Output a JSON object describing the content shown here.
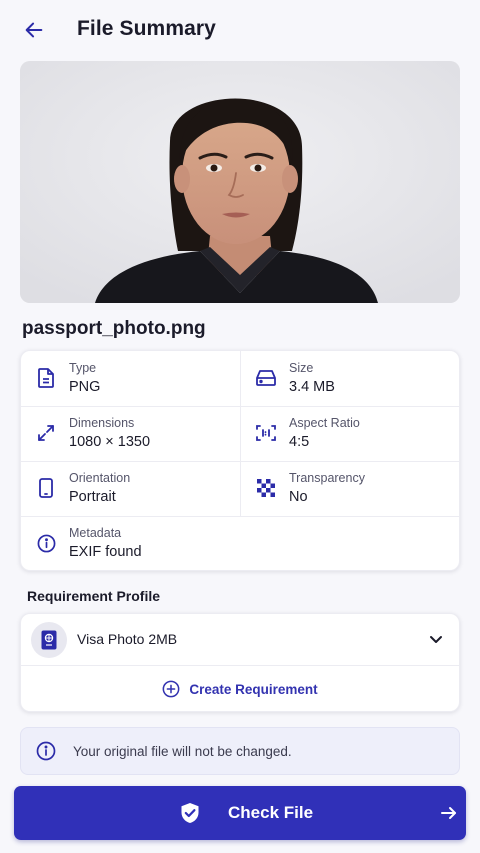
{
  "header": {
    "title": "File Summary"
  },
  "file": {
    "name": "passport_photo.png"
  },
  "details": {
    "type": {
      "label": "Type",
      "value": "PNG"
    },
    "size": {
      "label": "Size",
      "value": "3.4 MB"
    },
    "dimensions": {
      "label": "Dimensions",
      "value": "1080 × 1350"
    },
    "aspect_ratio": {
      "label": "Aspect Ratio",
      "value": "4:5"
    },
    "orientation": {
      "label": "Orientation",
      "value": "Portrait"
    },
    "transparency": {
      "label": "Transparency",
      "value": "No"
    },
    "metadata": {
      "label": "Metadata",
      "value": "EXIF found"
    }
  },
  "requirement": {
    "section_label": "Requirement Profile",
    "selected_profile": "Visa Photo 2MB",
    "create_label": "Create Requirement"
  },
  "notice": {
    "text": "Your original file will not be changed."
  },
  "cta": {
    "label": "Check File"
  },
  "colors": {
    "accent": "#3030b8",
    "icon": "#2b2ba8"
  }
}
